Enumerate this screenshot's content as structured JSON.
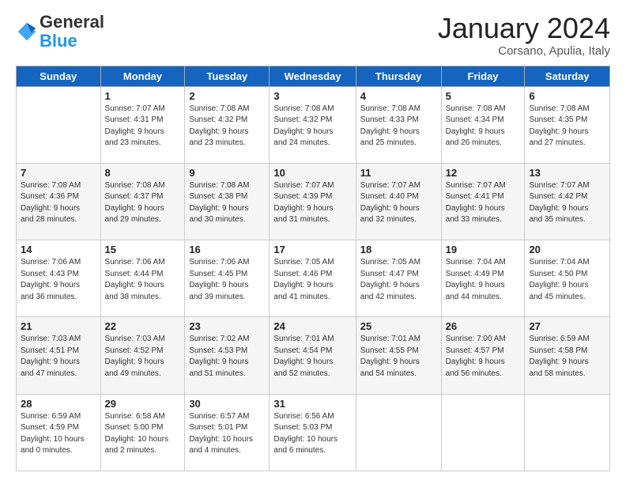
{
  "header": {
    "logo": {
      "general": "General",
      "blue": "Blue"
    },
    "title": "January 2024",
    "subtitle": "Corsano, Apulia, Italy"
  },
  "weekdays": [
    "Sunday",
    "Monday",
    "Tuesday",
    "Wednesday",
    "Thursday",
    "Friday",
    "Saturday"
  ],
  "weeks": [
    [
      {
        "day": "",
        "info": ""
      },
      {
        "day": "1",
        "info": "Sunrise: 7:07 AM\nSunset: 4:31 PM\nDaylight: 9 hours\nand 23 minutes."
      },
      {
        "day": "2",
        "info": "Sunrise: 7:08 AM\nSunset: 4:32 PM\nDaylight: 9 hours\nand 23 minutes."
      },
      {
        "day": "3",
        "info": "Sunrise: 7:08 AM\nSunset: 4:32 PM\nDaylight: 9 hours\nand 24 minutes."
      },
      {
        "day": "4",
        "info": "Sunrise: 7:08 AM\nSunset: 4:33 PM\nDaylight: 9 hours\nand 25 minutes."
      },
      {
        "day": "5",
        "info": "Sunrise: 7:08 AM\nSunset: 4:34 PM\nDaylight: 9 hours\nand 26 minutes."
      },
      {
        "day": "6",
        "info": "Sunrise: 7:08 AM\nSunset: 4:35 PM\nDaylight: 9 hours\nand 27 minutes."
      }
    ],
    [
      {
        "day": "7",
        "info": "Sunrise: 7:08 AM\nSunset: 4:36 PM\nDaylight: 9 hours\nand 28 minutes."
      },
      {
        "day": "8",
        "info": "Sunrise: 7:08 AM\nSunset: 4:37 PM\nDaylight: 9 hours\nand 29 minutes."
      },
      {
        "day": "9",
        "info": "Sunrise: 7:08 AM\nSunset: 4:38 PM\nDaylight: 9 hours\nand 30 minutes."
      },
      {
        "day": "10",
        "info": "Sunrise: 7:07 AM\nSunset: 4:39 PM\nDaylight: 9 hours\nand 31 minutes."
      },
      {
        "day": "11",
        "info": "Sunrise: 7:07 AM\nSunset: 4:40 PM\nDaylight: 9 hours\nand 32 minutes."
      },
      {
        "day": "12",
        "info": "Sunrise: 7:07 AM\nSunset: 4:41 PM\nDaylight: 9 hours\nand 33 minutes."
      },
      {
        "day": "13",
        "info": "Sunrise: 7:07 AM\nSunset: 4:42 PM\nDaylight: 9 hours\nand 35 minutes."
      }
    ],
    [
      {
        "day": "14",
        "info": "Sunrise: 7:06 AM\nSunset: 4:43 PM\nDaylight: 9 hours\nand 36 minutes."
      },
      {
        "day": "15",
        "info": "Sunrise: 7:06 AM\nSunset: 4:44 PM\nDaylight: 9 hours\nand 38 minutes."
      },
      {
        "day": "16",
        "info": "Sunrise: 7:06 AM\nSunset: 4:45 PM\nDaylight: 9 hours\nand 39 minutes."
      },
      {
        "day": "17",
        "info": "Sunrise: 7:05 AM\nSunset: 4:46 PM\nDaylight: 9 hours\nand 41 minutes."
      },
      {
        "day": "18",
        "info": "Sunrise: 7:05 AM\nSunset: 4:47 PM\nDaylight: 9 hours\nand 42 minutes."
      },
      {
        "day": "19",
        "info": "Sunrise: 7:04 AM\nSunset: 4:49 PM\nDaylight: 9 hours\nand 44 minutes."
      },
      {
        "day": "20",
        "info": "Sunrise: 7:04 AM\nSunset: 4:50 PM\nDaylight: 9 hours\nand 45 minutes."
      }
    ],
    [
      {
        "day": "21",
        "info": "Sunrise: 7:03 AM\nSunset: 4:51 PM\nDaylight: 9 hours\nand 47 minutes."
      },
      {
        "day": "22",
        "info": "Sunrise: 7:03 AM\nSunset: 4:52 PM\nDaylight: 9 hours\nand 49 minutes."
      },
      {
        "day": "23",
        "info": "Sunrise: 7:02 AM\nSunset: 4:53 PM\nDaylight: 9 hours\nand 51 minutes."
      },
      {
        "day": "24",
        "info": "Sunrise: 7:01 AM\nSunset: 4:54 PM\nDaylight: 9 hours\nand 52 minutes."
      },
      {
        "day": "25",
        "info": "Sunrise: 7:01 AM\nSunset: 4:55 PM\nDaylight: 9 hours\nand 54 minutes."
      },
      {
        "day": "26",
        "info": "Sunrise: 7:00 AM\nSunset: 4:57 PM\nDaylight: 9 hours\nand 56 minutes."
      },
      {
        "day": "27",
        "info": "Sunrise: 6:59 AM\nSunset: 4:58 PM\nDaylight: 9 hours\nand 58 minutes."
      }
    ],
    [
      {
        "day": "28",
        "info": "Sunrise: 6:59 AM\nSunset: 4:59 PM\nDaylight: 10 hours\nand 0 minutes."
      },
      {
        "day": "29",
        "info": "Sunrise: 6:58 AM\nSunset: 5:00 PM\nDaylight: 10 hours\nand 2 minutes."
      },
      {
        "day": "30",
        "info": "Sunrise: 6:57 AM\nSunset: 5:01 PM\nDaylight: 10 hours\nand 4 minutes."
      },
      {
        "day": "31",
        "info": "Sunrise: 6:56 AM\nSunset: 5:03 PM\nDaylight: 10 hours\nand 6 minutes."
      },
      {
        "day": "",
        "info": ""
      },
      {
        "day": "",
        "info": ""
      },
      {
        "day": "",
        "info": ""
      }
    ]
  ]
}
